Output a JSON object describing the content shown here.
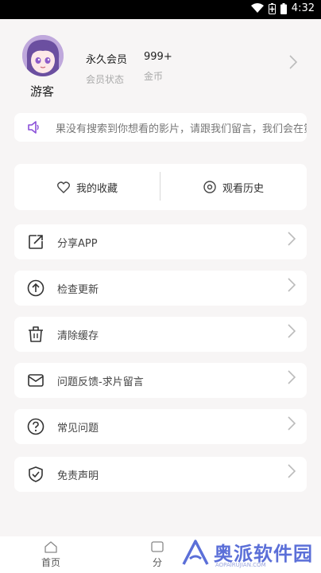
{
  "status_bar": {
    "time": "4:32",
    "icons": [
      "wifi-icon",
      "battery-saver-icon",
      "battery-icon"
    ]
  },
  "profile": {
    "nickname": "游客",
    "membership_value": "永久会员",
    "membership_label": "会员状态",
    "coins_value": "999+",
    "coins_label": "金币"
  },
  "notice": {
    "text": "果没有搜索到你想看的影片，请跟我们留言，我们会在第"
  },
  "shortcuts": {
    "favorites": "我的收藏",
    "history": "观看历史"
  },
  "menu": [
    {
      "label": "分享APP",
      "icon": "share-icon"
    },
    {
      "label": "检查更新",
      "icon": "update-icon"
    },
    {
      "label": "清除缓存",
      "icon": "trash-icon"
    },
    {
      "label": "问题反馈-求片留言",
      "icon": "mail-icon"
    },
    {
      "label": "常见问题",
      "icon": "help-icon"
    },
    {
      "label": "免责声明",
      "icon": "shield-icon"
    }
  ],
  "tabbar": {
    "home": "首页",
    "category": "分"
  },
  "watermark": {
    "text": "奥派软件园",
    "sub": "AOPAIRUJIAN.COM"
  },
  "colors": {
    "accent": "#8a4fd8",
    "background": "#f7f5f5",
    "watermark": "#5b6fd8"
  }
}
